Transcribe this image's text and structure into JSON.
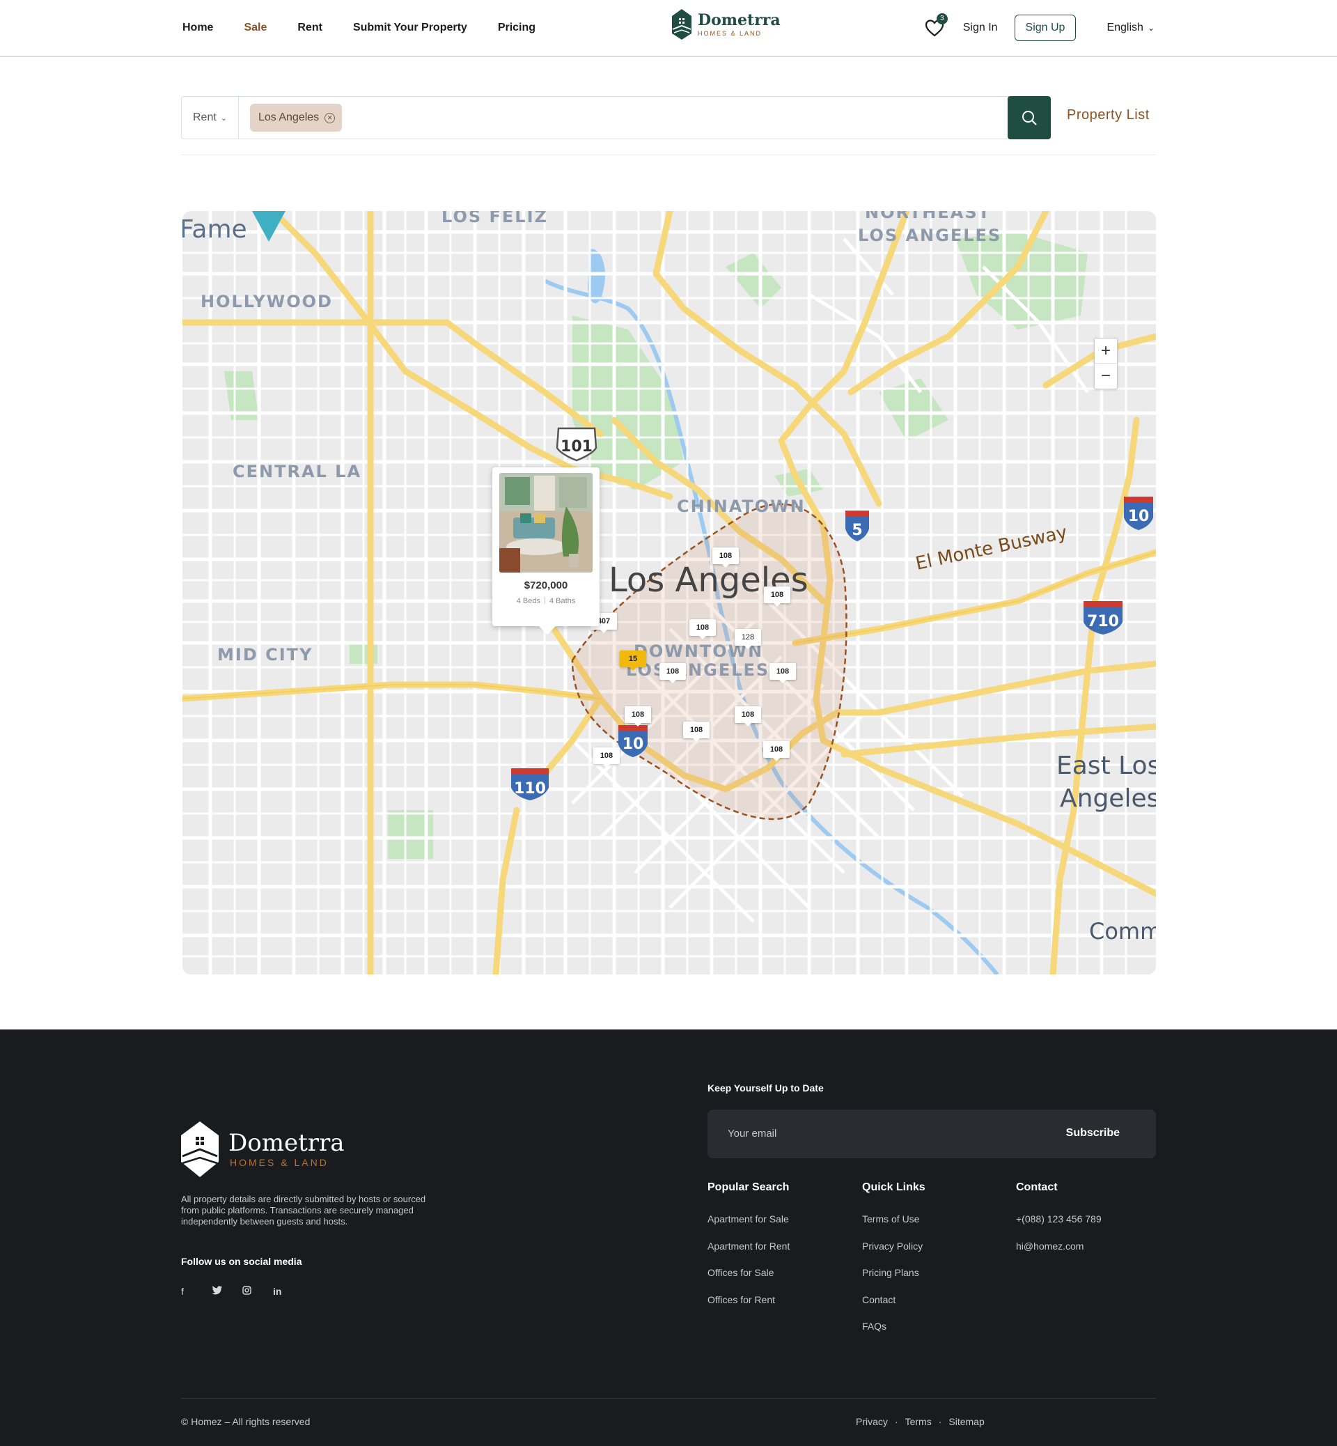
{
  "nav": {
    "items": [
      {
        "label": "Home",
        "active": false
      },
      {
        "label": "Sale",
        "active": true
      },
      {
        "label": "Rent",
        "active": false
      },
      {
        "label": "Submit Your Property",
        "active": false
      },
      {
        "label": "Pricing",
        "active": false
      }
    ]
  },
  "brand": {
    "name": "Dometrra",
    "tagline": "HOMES & LAND"
  },
  "header": {
    "favorites_count": "3",
    "sign_in": "Sign In",
    "sign_up": "Sign Up",
    "language": "English"
  },
  "search": {
    "type": "Rent",
    "chip": "Los Angeles",
    "property_list": "Property List"
  },
  "map": {
    "labels": {
      "hollywood": "HOLLYWOOD",
      "los_feliz": "LOS FELIZ",
      "northeast": "NORTHEAST",
      "los_angeles_ne": "LOS ANGELES",
      "central_la": "CENTRAL LA",
      "mid_city": "MID CITY",
      "chinatown": "CHINATOWN",
      "los_angeles": "Los Angeles",
      "downtown": "DOWNTOWN",
      "downtown_la": "LOS ANGELES",
      "el_monte": "El Monte Busway",
      "east_los": "East Los",
      "east_angeles": "Angeles",
      "comm": "Comm",
      "fame": "Fame"
    },
    "shields": {
      "s101": "101",
      "s5": "5",
      "s10a": "10",
      "s10b": "10",
      "s110": "110",
      "s710": "710"
    },
    "markers": [
      "108",
      "108",
      "407",
      "108",
      "128",
      "15",
      "108",
      "108",
      "108",
      "108",
      "108",
      "108",
      "108"
    ],
    "zoom_in": "+",
    "zoom_out": "−",
    "card": {
      "price": "$720,000",
      "beds": "4 Beds",
      "baths": "4 Baths"
    }
  },
  "footer": {
    "brand_name": "Dometrra",
    "brand_tagline": "HOMES & LAND",
    "description": "All property details are directly submitted by hosts or sourced from public platforms. Transactions are securely managed independently between guests and hosts.",
    "follow": "Follow us on social media",
    "social": [
      "facebook-icon",
      "twitter-icon",
      "instagram-icon",
      "linkedin-icon"
    ],
    "keep_up": "Keep Yourself Up to Date",
    "email_placeholder": "Your email",
    "subscribe": "Subscribe",
    "columns": [
      {
        "title": "Popular Search",
        "links": [
          "Apartment for Sale",
          "Apartment for Rent",
          "Offices for Sale",
          "Offices for Rent"
        ]
      },
      {
        "title": "Quick Links",
        "links": [
          "Terms of Use",
          "Privacy Policy",
          "Pricing Plans",
          "Contact",
          "FAQs"
        ]
      },
      {
        "title": "Contact",
        "links": [
          "+(088) 123 456 789",
          "hi@homez.com"
        ]
      }
    ],
    "copyright": "© Homez – All rights reserved",
    "bottom_links": [
      "Privacy",
      "Terms",
      "Sitemap"
    ]
  },
  "colors": {
    "brand_green": "#1f4d42",
    "accent_brown": "#8a5426",
    "highlight_marker": "#f0b90b",
    "footer_bg": "#1a1b1f"
  }
}
